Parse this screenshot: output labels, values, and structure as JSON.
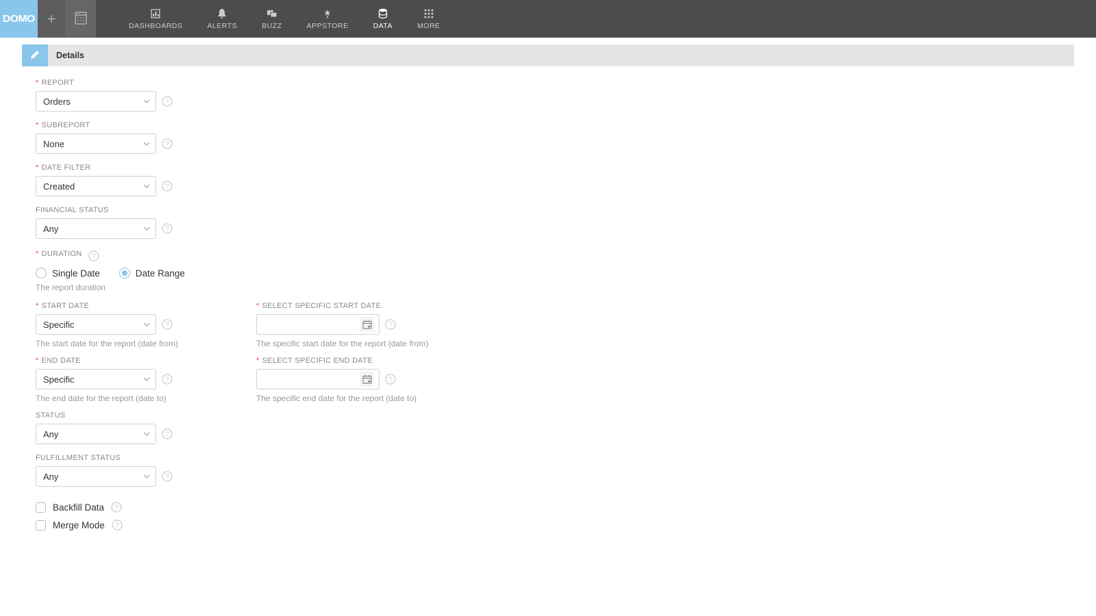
{
  "brand": "DOMO",
  "nav": {
    "items": [
      {
        "label": "DASHBOARDS",
        "icon": "dashboards"
      },
      {
        "label": "ALERTS",
        "icon": "bell"
      },
      {
        "label": "BUZZ",
        "icon": "chat"
      },
      {
        "label": "APPSTORE",
        "icon": "plant"
      },
      {
        "label": "DATA",
        "icon": "data",
        "active": true
      },
      {
        "label": "MORE",
        "icon": "grid"
      }
    ]
  },
  "section": {
    "title": "Details"
  },
  "form": {
    "report": {
      "label": "Report",
      "required": true,
      "value": "Orders"
    },
    "subreport": {
      "label": "Subreport",
      "required": true,
      "value": "None"
    },
    "date_filter": {
      "label": "Date Filter",
      "required": true,
      "value": "Created"
    },
    "financial_status": {
      "label": "Financial Status",
      "required": false,
      "value": "Any"
    },
    "duration": {
      "label": "Duration",
      "required": true,
      "options": [
        "Single Date",
        "Date Range"
      ],
      "selected": "Date Range",
      "hint": "The report duration"
    },
    "start_date": {
      "label": "Start Date",
      "required": true,
      "value": "Specific",
      "hint": "The start date for the report (date from)"
    },
    "start_date_specific": {
      "label": "Select Specific Start Date",
      "required": true,
      "value": "",
      "hint": "The specific start date for the report (date from)"
    },
    "end_date": {
      "label": "End Date",
      "required": true,
      "value": "Specific",
      "hint": "The end date for the report (date to)"
    },
    "end_date_specific": {
      "label": "Select Specific End Date",
      "required": true,
      "value": "",
      "hint": "The specific end date for the report (date to)"
    },
    "status": {
      "label": "Status",
      "required": false,
      "value": "Any"
    },
    "fulfillment_status": {
      "label": "Fulfillment Status",
      "required": false,
      "value": "Any"
    },
    "backfill": {
      "label": "Backfill Data",
      "checked": false
    },
    "merge": {
      "label": "Merge Mode",
      "checked": false
    }
  }
}
